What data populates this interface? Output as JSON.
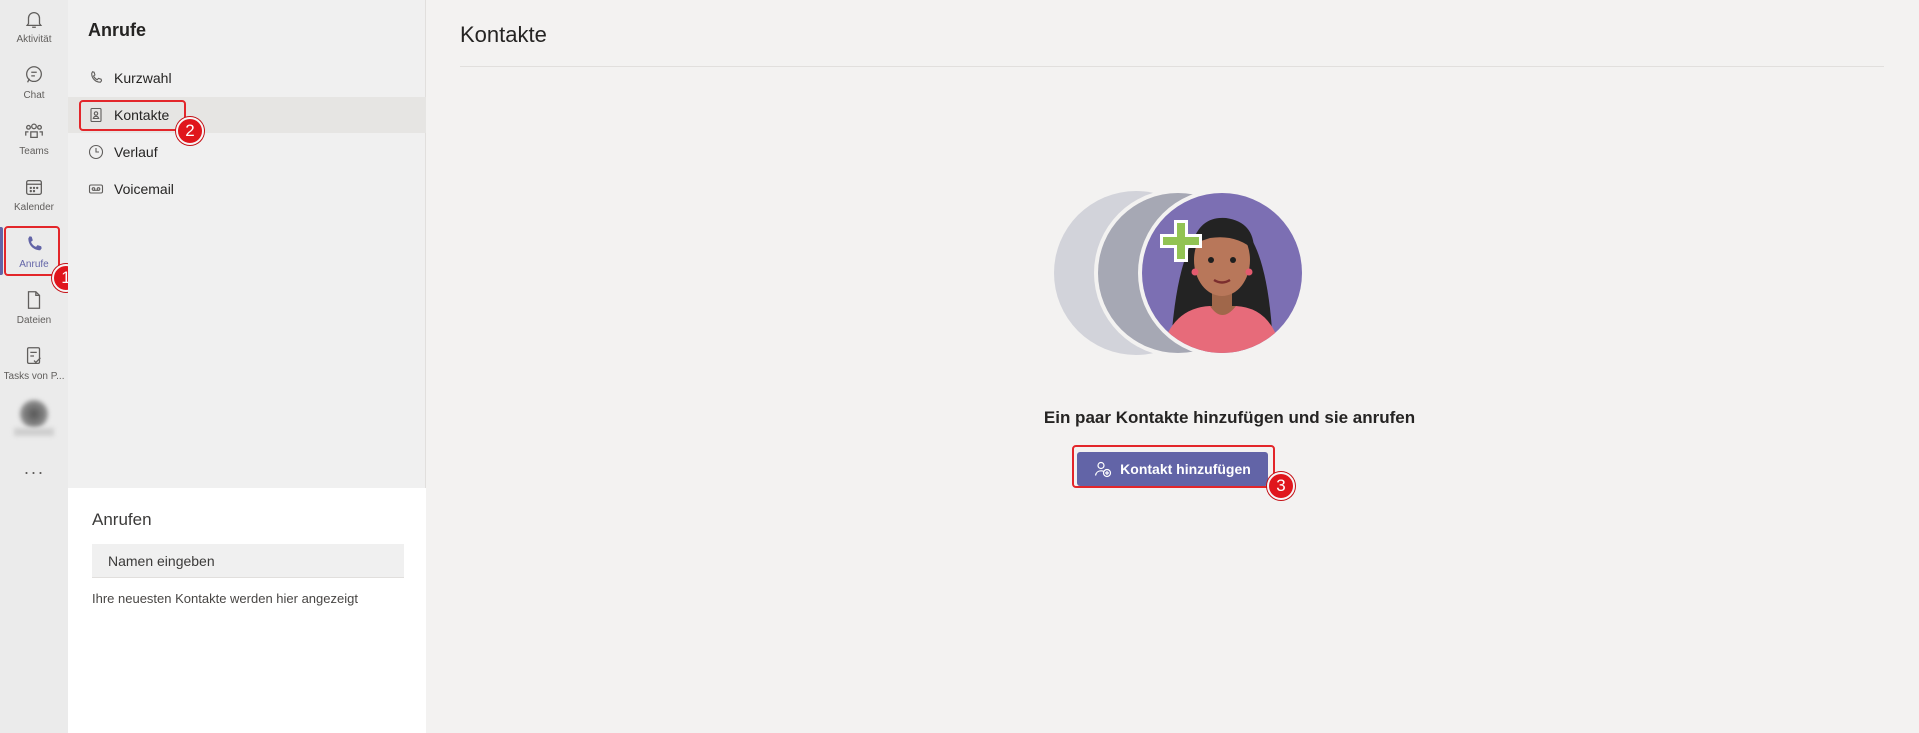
{
  "rail": {
    "items": [
      {
        "label": "Aktivität",
        "icon": "bell-icon"
      },
      {
        "label": "Chat",
        "icon": "chat-icon"
      },
      {
        "label": "Teams",
        "icon": "teams-icon"
      },
      {
        "label": "Kalender",
        "icon": "calendar-icon"
      },
      {
        "label": "Anrufe",
        "icon": "phone-icon"
      },
      {
        "label": "Dateien",
        "icon": "file-icon"
      },
      {
        "label": "Tasks von P...",
        "icon": "tasks-icon"
      }
    ],
    "more": "···"
  },
  "left_pane": {
    "title": "Anrufe",
    "nav": [
      {
        "label": "Kurzwahl",
        "icon": "phone-outline-icon"
      },
      {
        "label": "Kontakte",
        "icon": "contact-card-icon"
      },
      {
        "label": "Verlauf",
        "icon": "clock-icon"
      },
      {
        "label": "Voicemail",
        "icon": "voicemail-icon"
      }
    ],
    "call_panel": {
      "title": "Anrufen",
      "input_placeholder": "Namen eingeben",
      "hint": "Ihre neuesten Kontakte werden hier angezeigt"
    }
  },
  "main": {
    "title": "Kontakte",
    "empty_title": "Ein paar Kontakte hinzufügen und sie anrufen",
    "add_button": "Kontakt hinzufügen"
  },
  "annotations": [
    "1",
    "2",
    "3"
  ],
  "colors": {
    "accent": "#6264a7",
    "annotation": "#e0161c",
    "plus": "#92c353"
  }
}
